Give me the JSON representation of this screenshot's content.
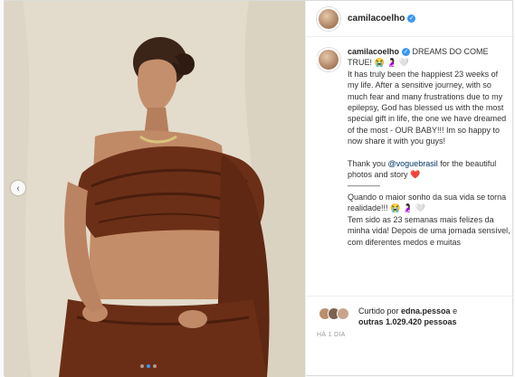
{
  "post": {
    "username": "camilacoelho",
    "verified": true
  },
  "caption": {
    "username": "camilacoelho",
    "headline": "DREAMS DO COME TRUE! 😭 🤰🏻 🤍",
    "paragraph_en": "It has truly been the happiest 23 weeks of my life. After a sensitive journey, with so much fear and many frustrations due to my epilepsy, God has blessed us with the most special gift in life, the one we have dreamed of the most - OUR BABY!!! Im so happy to now share it with you guys!",
    "thanks_prefix": "Thank you ",
    "thanks_mention": "@voguebrasil",
    "thanks_suffix": " for the beautiful photos and story ",
    "heart": "❤️",
    "divider": "————",
    "paragraph_pt_1": "Quando o maior sonho da sua vida se torna realidade!!! 😭 🤰🏻 🤍",
    "paragraph_pt_2": "Tem sido as 23 semanas mais felizes da minha vida! Depois de uma jornada sensível, com diferentes medos e muitas"
  },
  "likes": {
    "prefix": "Curtido por ",
    "first_user": "edna.pessoa",
    "middle": " e ",
    "others": "outras 1.029.420 pessoas"
  },
  "timestamp": "HÁ 1 DIA",
  "carousel": {
    "prev_icon": "chevron-left-icon",
    "dots_total": 3,
    "active_dot": 1
  },
  "colors": {
    "link": "#003569",
    "verified": "#3897f0",
    "heart": "#ed4956"
  }
}
